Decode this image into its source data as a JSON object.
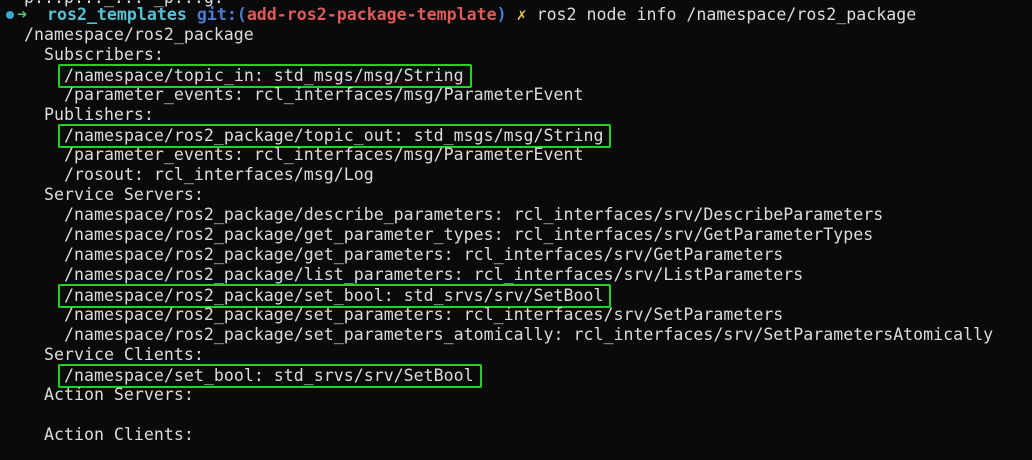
{
  "prompt": {
    "arrow": "➜",
    "cwd": "ros2_templates",
    "git_label": "git:(",
    "branch": "add-ros2-package-template",
    "git_close": ")",
    "dirty": "✗",
    "command": "ros2 node info /namespace/ros2_package"
  },
  "previous_line": "p...p..._... _p...g.",
  "output": {
    "node": "/namespace/ros2_package",
    "subscribers_header": "Subscribers:",
    "subscribers": [
      "/namespace/topic_in: std_msgs/msg/String",
      "/parameter_events: rcl_interfaces/msg/ParameterEvent"
    ],
    "publishers_header": "Publishers:",
    "publishers": [
      "/namespace/ros2_package/topic_out: std_msgs/msg/String",
      "/parameter_events: rcl_interfaces/msg/ParameterEvent",
      "/rosout: rcl_interfaces/msg/Log"
    ],
    "service_servers_header": "Service Servers:",
    "service_servers": [
      "/namespace/ros2_package/describe_parameters: rcl_interfaces/srv/DescribeParameters",
      "/namespace/ros2_package/get_parameter_types: rcl_interfaces/srv/GetParameterTypes",
      "/namespace/ros2_package/get_parameters: rcl_interfaces/srv/GetParameters",
      "/namespace/ros2_package/list_parameters: rcl_interfaces/srv/ListParameters",
      "/namespace/ros2_package/set_bool: std_srvs/srv/SetBool",
      "/namespace/ros2_package/set_parameters: rcl_interfaces/srv/SetParameters",
      "/namespace/ros2_package/set_parameters_atomically: rcl_interfaces/srv/SetParametersAtomically"
    ],
    "service_clients_header": "Service Clients:",
    "service_clients": [
      "/namespace/set_bool: std_srvs/srv/SetBool"
    ],
    "action_servers_header": "Action Servers:",
    "action_clients_header": "Action Clients:"
  },
  "highlight_color": "#22d322"
}
